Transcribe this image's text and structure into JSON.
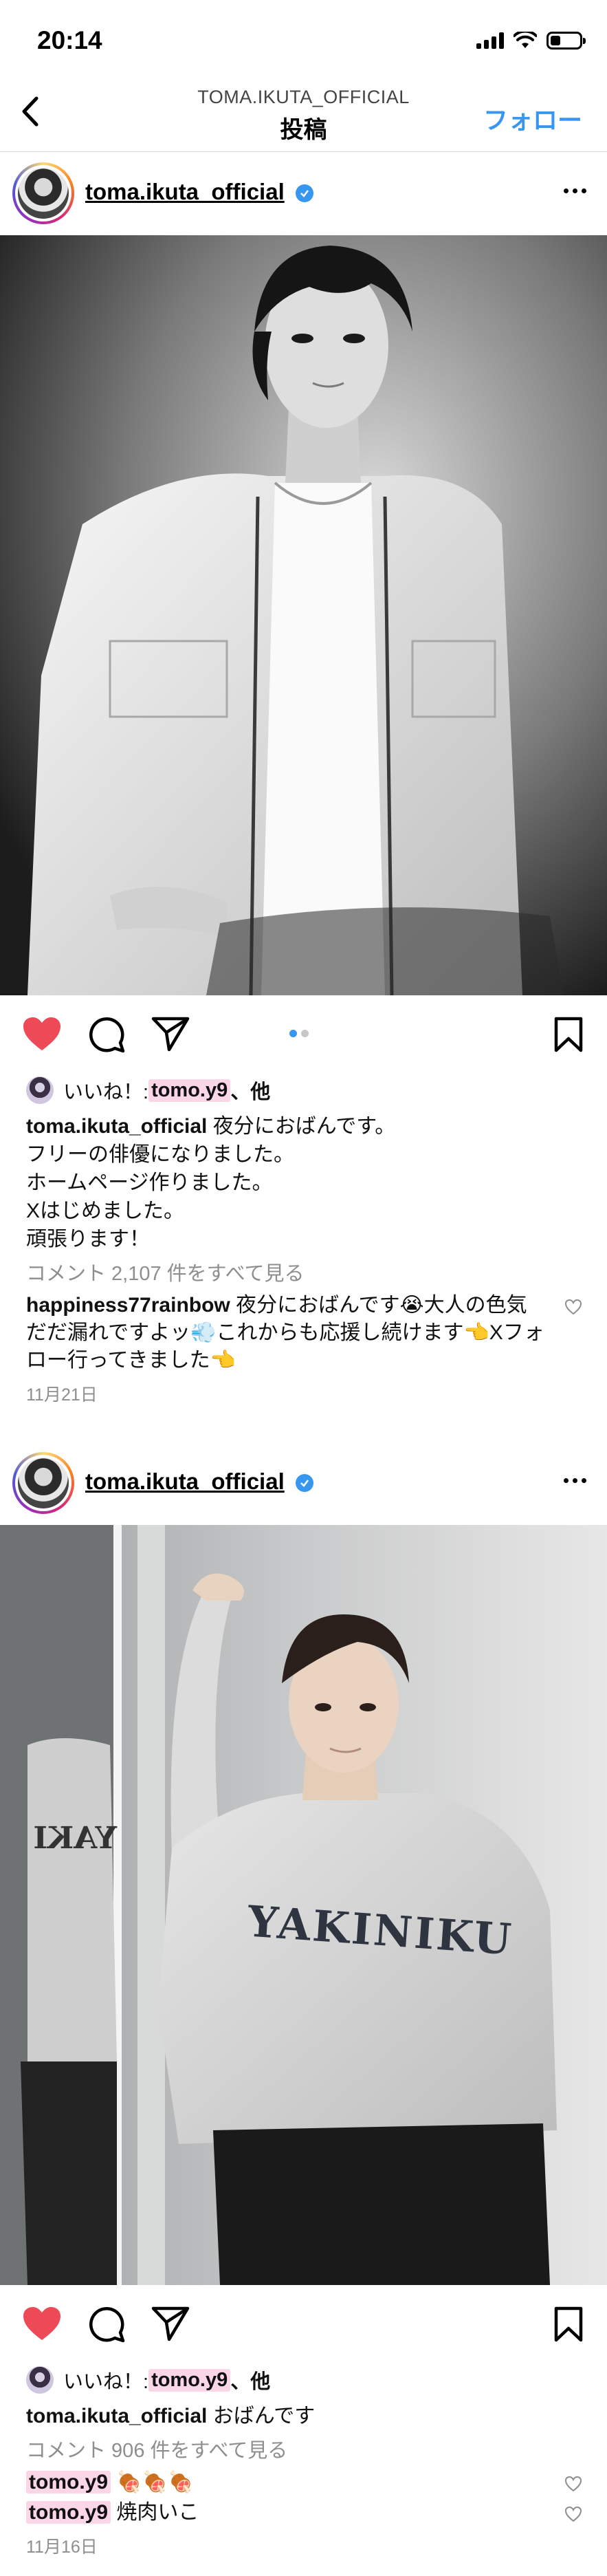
{
  "status_bar": {
    "time": "20:14",
    "battery_level": 0.35
  },
  "nav": {
    "subtitle": "TOMA.IKUTA_OFFICIAL",
    "title": "投稿",
    "follow_label": "フォロー",
    "back_icon": "chevron-left-icon"
  },
  "posts": [
    {
      "username": "toma.ikuta_official",
      "likes_prefix": "いいね！: ",
      "likes_user": "tomo.y9",
      "likes_suffix": "、他",
      "caption_lines": [
        "夜分におばんです。",
        "フリーの俳優になりました。",
        "ホームページ作りました。",
        "Xはじめました。",
        "頑張ります！"
      ],
      "view_comments": "コメント 2,107 件をすべて見る",
      "comments": [
        {
          "user": "happiness77rainbow",
          "text": "夜分におばんです😭大人の色気だだ漏れですよッ💨これからも応援し続けます👈Xフォロー行ってきました👈"
        }
      ],
      "date": "11月21日",
      "carousel_index": 1,
      "carousel_total": 2,
      "liked": true
    },
    {
      "username": "toma.ikuta_official",
      "likes_prefix": "いいね！: ",
      "likes_user": "tomo.y9",
      "likes_suffix": "、他",
      "caption_lines": [
        "おばんです"
      ],
      "view_comments": "コメント 906 件をすべて見る",
      "comments": [
        {
          "user": "tomo.y9",
          "text": "🍖🍖🍖"
        },
        {
          "user": "tomo.y9",
          "text": "焼肉いこ"
        }
      ],
      "date": "11月16日",
      "sweater_text": "YAKINIKU",
      "liked": true
    }
  ],
  "colors": {
    "accent": "#3797f0",
    "like": "#ed4956",
    "muted": "#8e8e8e",
    "highlight": "#fbd6e6"
  }
}
